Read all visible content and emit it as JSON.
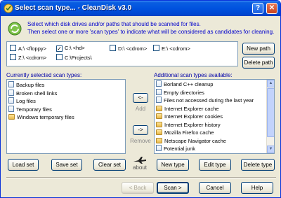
{
  "window": {
    "title": "Select scan type... - CleanDisk v3.0"
  },
  "intro": {
    "line1": "Select which disk drives and/or paths that should be scanned for files.",
    "line2": "Then select one or more 'scan types' to indicate what will be considered as candidates for cleaning."
  },
  "paths": [
    {
      "label": "A:\\ <floppy>",
      "checked": false
    },
    {
      "label": "C:\\ <hd>",
      "checked": true
    },
    {
      "label": "D:\\ <cdrom>",
      "checked": false
    },
    {
      "label": "E:\\ <cdrom>",
      "checked": false
    },
    {
      "label": "Z:\\ <cdrom>",
      "checked": false
    },
    {
      "label": "C:\\Projects\\",
      "checked": false
    }
  ],
  "buttons": {
    "new_path": "New path",
    "delete_path": "Delete path",
    "add": "<-",
    "add_label": "Add",
    "remove": "->",
    "remove_label": "Remove",
    "load_set": "Load set",
    "save_set": "Save set",
    "clear_set": "Clear set",
    "about": "about",
    "new_type": "New type",
    "edit_type": "Edit type",
    "delete_type": "Delete type",
    "back": "< Back",
    "scan": "Scan >",
    "cancel": "Cancel",
    "help": "Help"
  },
  "selected": {
    "label": "Currently selected scan types:",
    "items": [
      {
        "text": "Backup files",
        "icon": "document-icon"
      },
      {
        "text": "Broken shell links",
        "icon": "document-icon"
      },
      {
        "text": "Log files",
        "icon": "document-icon"
      },
      {
        "text": "Temporary files",
        "icon": "document-icon"
      },
      {
        "text": "Windows temporary files",
        "icon": "folder-icon"
      }
    ]
  },
  "available": {
    "label": "Additional scan types available:",
    "items": [
      {
        "text": "Borland C++ cleanup",
        "icon": "document-icon"
      },
      {
        "text": "Empty directories",
        "icon": "document-icon"
      },
      {
        "text": "Files not accessed during the last year",
        "icon": "document-icon"
      },
      {
        "text": "Internet Explorer cache",
        "icon": "folder-icon"
      },
      {
        "text": "Internet Explorer cookies",
        "icon": "folder-icon"
      },
      {
        "text": "Internet Explorer history",
        "icon": "folder-icon"
      },
      {
        "text": "Mozilla Firefox cache",
        "icon": "folder-icon"
      },
      {
        "text": "Netscape Navigator cache",
        "icon": "folder-icon"
      },
      {
        "text": "Potential junk",
        "icon": "document-icon"
      }
    ]
  },
  "colors": {
    "title_bar": "#0052df",
    "intro_text": "#0000cc",
    "label_text": "#0000aa"
  }
}
